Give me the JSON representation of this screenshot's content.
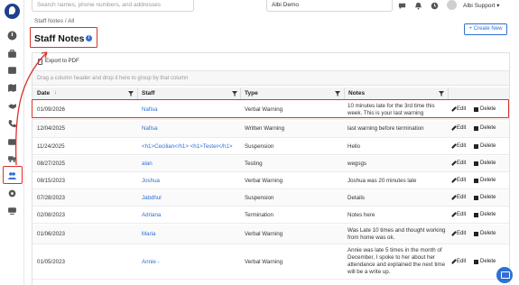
{
  "topbar": {
    "search_placeholder": "Search names, phone numbers, and addresses",
    "org_name": "Albi Demo",
    "user_name": "Albi Support ▾"
  },
  "header": {
    "breadcrumb": "Staff Notes / All",
    "title": "Staff Notes",
    "create_label": "+ Create New"
  },
  "grid": {
    "export_label": "Export to PDF",
    "group_hint": "Drag a column header and drop it here to group by that column",
    "columns": [
      "Date",
      "Staff",
      "Type",
      "Notes"
    ],
    "rows": [
      {
        "date": "01/09/2026",
        "staff": "Nafisa",
        "type": "Verbal Warning",
        "notes": "10 minutes late for the 3rd time this week. This is your last warning"
      },
      {
        "date": "12/04/2025",
        "staff": "Nafisa",
        "type": "Written Warning",
        "notes": "last warning before termination"
      },
      {
        "date": "11/24/2025",
        "staff": "<h1>Cecilian</h1> <h1>Tester</h1>",
        "type": "Suspension",
        "notes": "Hello"
      },
      {
        "date": "08/27/2025",
        "staff": "alan",
        "type": "Testing",
        "notes": "wegsgs"
      },
      {
        "date": "08/15/2023",
        "staff": "Joshua",
        "type": "Verbal Warning",
        "notes": "Joshua was 20 minutes late"
      },
      {
        "date": "07/28/2023",
        "staff": "Jabdhul",
        "type": "Suspension",
        "notes": "Details"
      },
      {
        "date": "02/08/2023",
        "staff": "Adriana",
        "type": "Termination",
        "notes": "Notes here"
      },
      {
        "date": "01/06/2023",
        "staff": "Maria",
        "type": "Verbal Warning",
        "notes": "Was Late 10 times and thought working from home was ok."
      },
      {
        "date": "01/05/2023",
        "staff": "Annie -",
        "type": "Verbal Warning",
        "notes": "Annie was late 5 times in the month of December, I spoke to her about her attendance and explained the next time will be a write up."
      }
    ],
    "edit_label": "Edit",
    "delete_label": "Delete"
  },
  "colors": {
    "accent": "#2f6fd6",
    "highlight": "#d9322b"
  }
}
